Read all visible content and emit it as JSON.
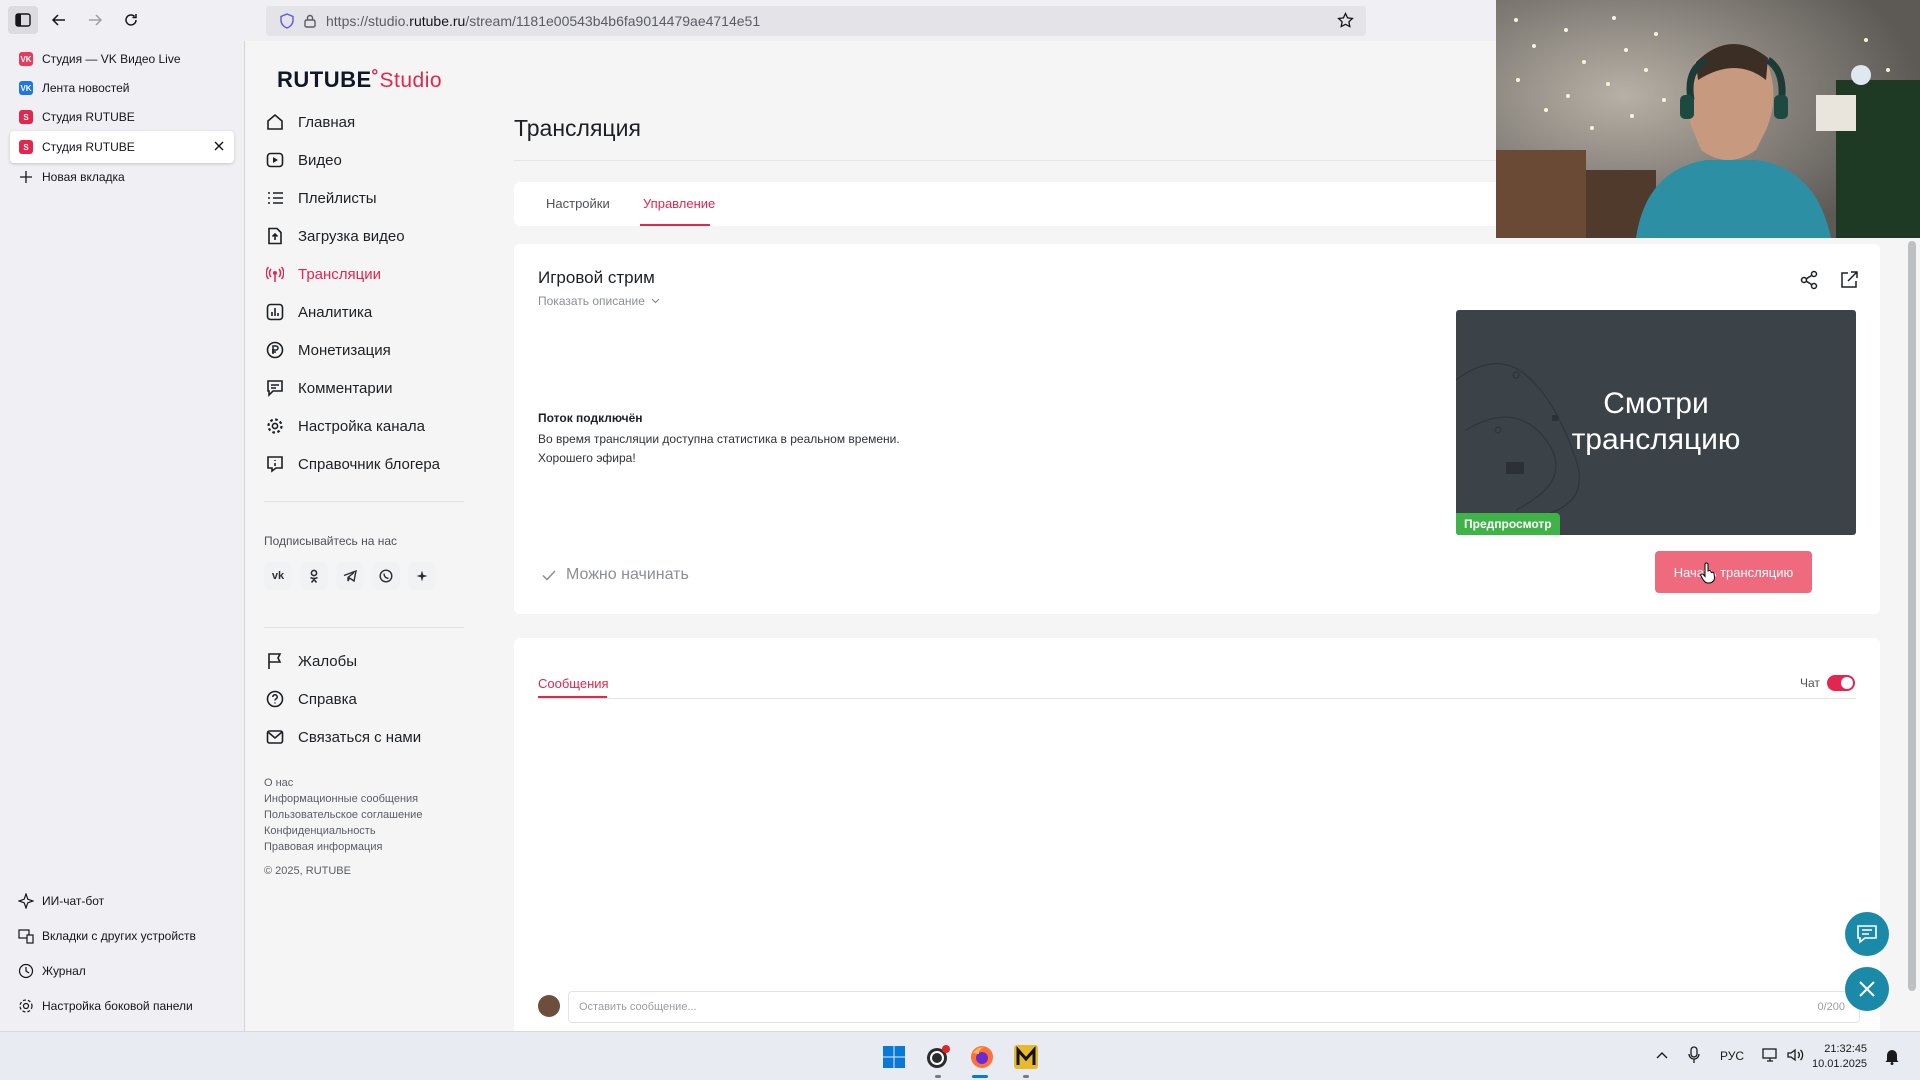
{
  "browser": {
    "url_prefix": "https://studio.",
    "url_host": "rutube.ru",
    "url_path": "/stream/1181e00543b4b6fa9014479ae4714e51"
  },
  "vertical_tabs": {
    "tabs": [
      {
        "label": "Студия — VK Видео Live",
        "favicon_color": "#e83a5a",
        "favicon_text": "VK"
      },
      {
        "label": "Лента новостей",
        "favicon_color": "#1e76e6",
        "favicon_text": "VK"
      },
      {
        "label": "Студия RUTUBE",
        "favicon_color": "#e3264d",
        "favicon_text": "S"
      },
      {
        "label": "Студия RUTUBE",
        "favicon_color": "#e3264d",
        "favicon_text": "S"
      }
    ],
    "new_tab": "Новая вкладка",
    "bottom": {
      "ai_chat": "ИИ-чат-бот",
      "other_devices": "Вкладки с других устройств",
      "history": "Журнал",
      "sidebar_settings": "Настройка боковой панели"
    }
  },
  "studio": {
    "logo_brand": "RUTUBE",
    "logo_product": "Studio",
    "nav": [
      {
        "label": "Главная",
        "icon": "home-icon"
      },
      {
        "label": "Видео",
        "icon": "video-icon"
      },
      {
        "label": "Плейлисты",
        "icon": "playlist-icon"
      },
      {
        "label": "Загрузка видео",
        "icon": "upload-icon"
      },
      {
        "label": "Трансляции",
        "icon": "broadcast-icon"
      },
      {
        "label": "Аналитика",
        "icon": "analytics-icon"
      },
      {
        "label": "Монетизация",
        "icon": "ruble-icon"
      },
      {
        "label": "Комментарии",
        "icon": "comment-icon"
      },
      {
        "label": "Настройка канала",
        "icon": "gear-icon"
      },
      {
        "label": "Справочник блогера",
        "icon": "info-icon"
      }
    ],
    "follow_label": "Подписывайтесь на нас",
    "secondary_nav": [
      {
        "label": "Жалобы",
        "icon": "flag-icon"
      },
      {
        "label": "Справка",
        "icon": "help-icon"
      },
      {
        "label": "Связаться с нами",
        "icon": "mail-icon"
      }
    ],
    "footer_links": [
      "О нас",
      "Информационные сообщения",
      "Пользовательское соглашение",
      "Конфиденциальность",
      "Правовая информация"
    ],
    "copyright": "© 2025, RUTUBE"
  },
  "main": {
    "title": "Трансляция",
    "tabs": [
      {
        "label": "Настройки"
      },
      {
        "label": "Управление"
      }
    ],
    "stream": {
      "name": "Игровой стрим",
      "show_description": "Показать описание",
      "status_title": "Поток подключён",
      "status_line1": "Во время трансляции доступна статистика в реальном времени.",
      "status_line2": "Хорошего эфира!",
      "ready": "Можно начинать",
      "preview_line1": "Смотри",
      "preview_line2": "трансляцию",
      "preview_badge": "Предпросмотр",
      "start_button": "Начать трансляцию"
    },
    "chat": {
      "tab": "Сообщения",
      "toggle_label": "Чат",
      "toggle_on": true,
      "input_placeholder": "Оставить сообщение...",
      "counter": "0/200"
    }
  },
  "taskbar": {
    "language": "РУС",
    "time": "21:32:45",
    "date": "10.01.2025"
  }
}
